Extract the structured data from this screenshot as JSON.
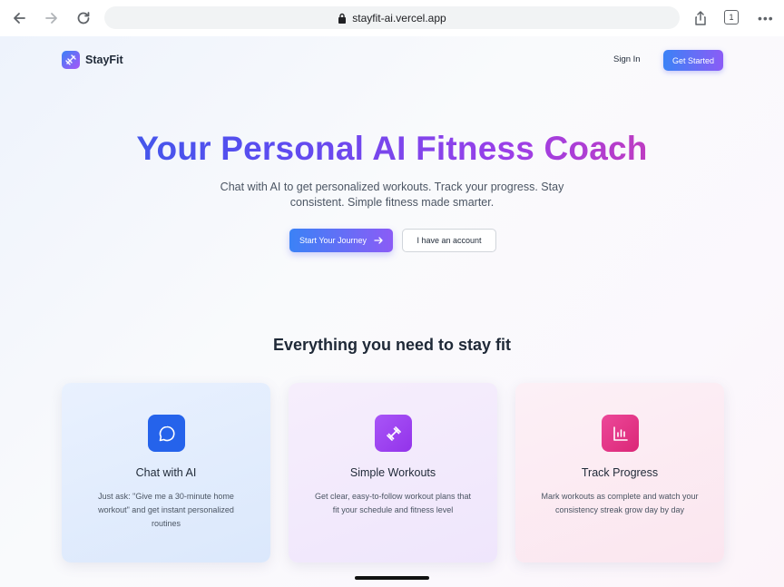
{
  "browser": {
    "url": "stayfit-ai.vercel.app",
    "tab_count": "1"
  },
  "header": {
    "logo_text": "StayFit",
    "sign_in": "Sign In",
    "get_started": "Get Started"
  },
  "hero": {
    "title": "Your Personal AI Fitness Coach",
    "subtitle": "Chat with AI to get personalized workouts. Track your progress. Stay consistent. Simple fitness made smarter.",
    "primary_cta": "Start Your Journey",
    "secondary_cta": "I have an account"
  },
  "features": {
    "heading": "Everything you need to stay fit",
    "cards": [
      {
        "icon": "chat-bubble-icon",
        "title": "Chat with AI",
        "description": "Just ask: \"Give me a 30-minute home workout\" and get instant personalized routines"
      },
      {
        "icon": "dumbbell-icon",
        "title": "Simple Workouts",
        "description": "Get clear, easy-to-follow workout plans that fit your schedule and fitness level"
      },
      {
        "icon": "bar-chart-icon",
        "title": "Track Progress",
        "description": "Mark workouts as complete and watch your consistency streak grow day by day"
      }
    ]
  },
  "colors": {
    "brand_blue": "#3b82f6",
    "brand_purple": "#8b5cf6",
    "brand_pink": "#db2777"
  }
}
